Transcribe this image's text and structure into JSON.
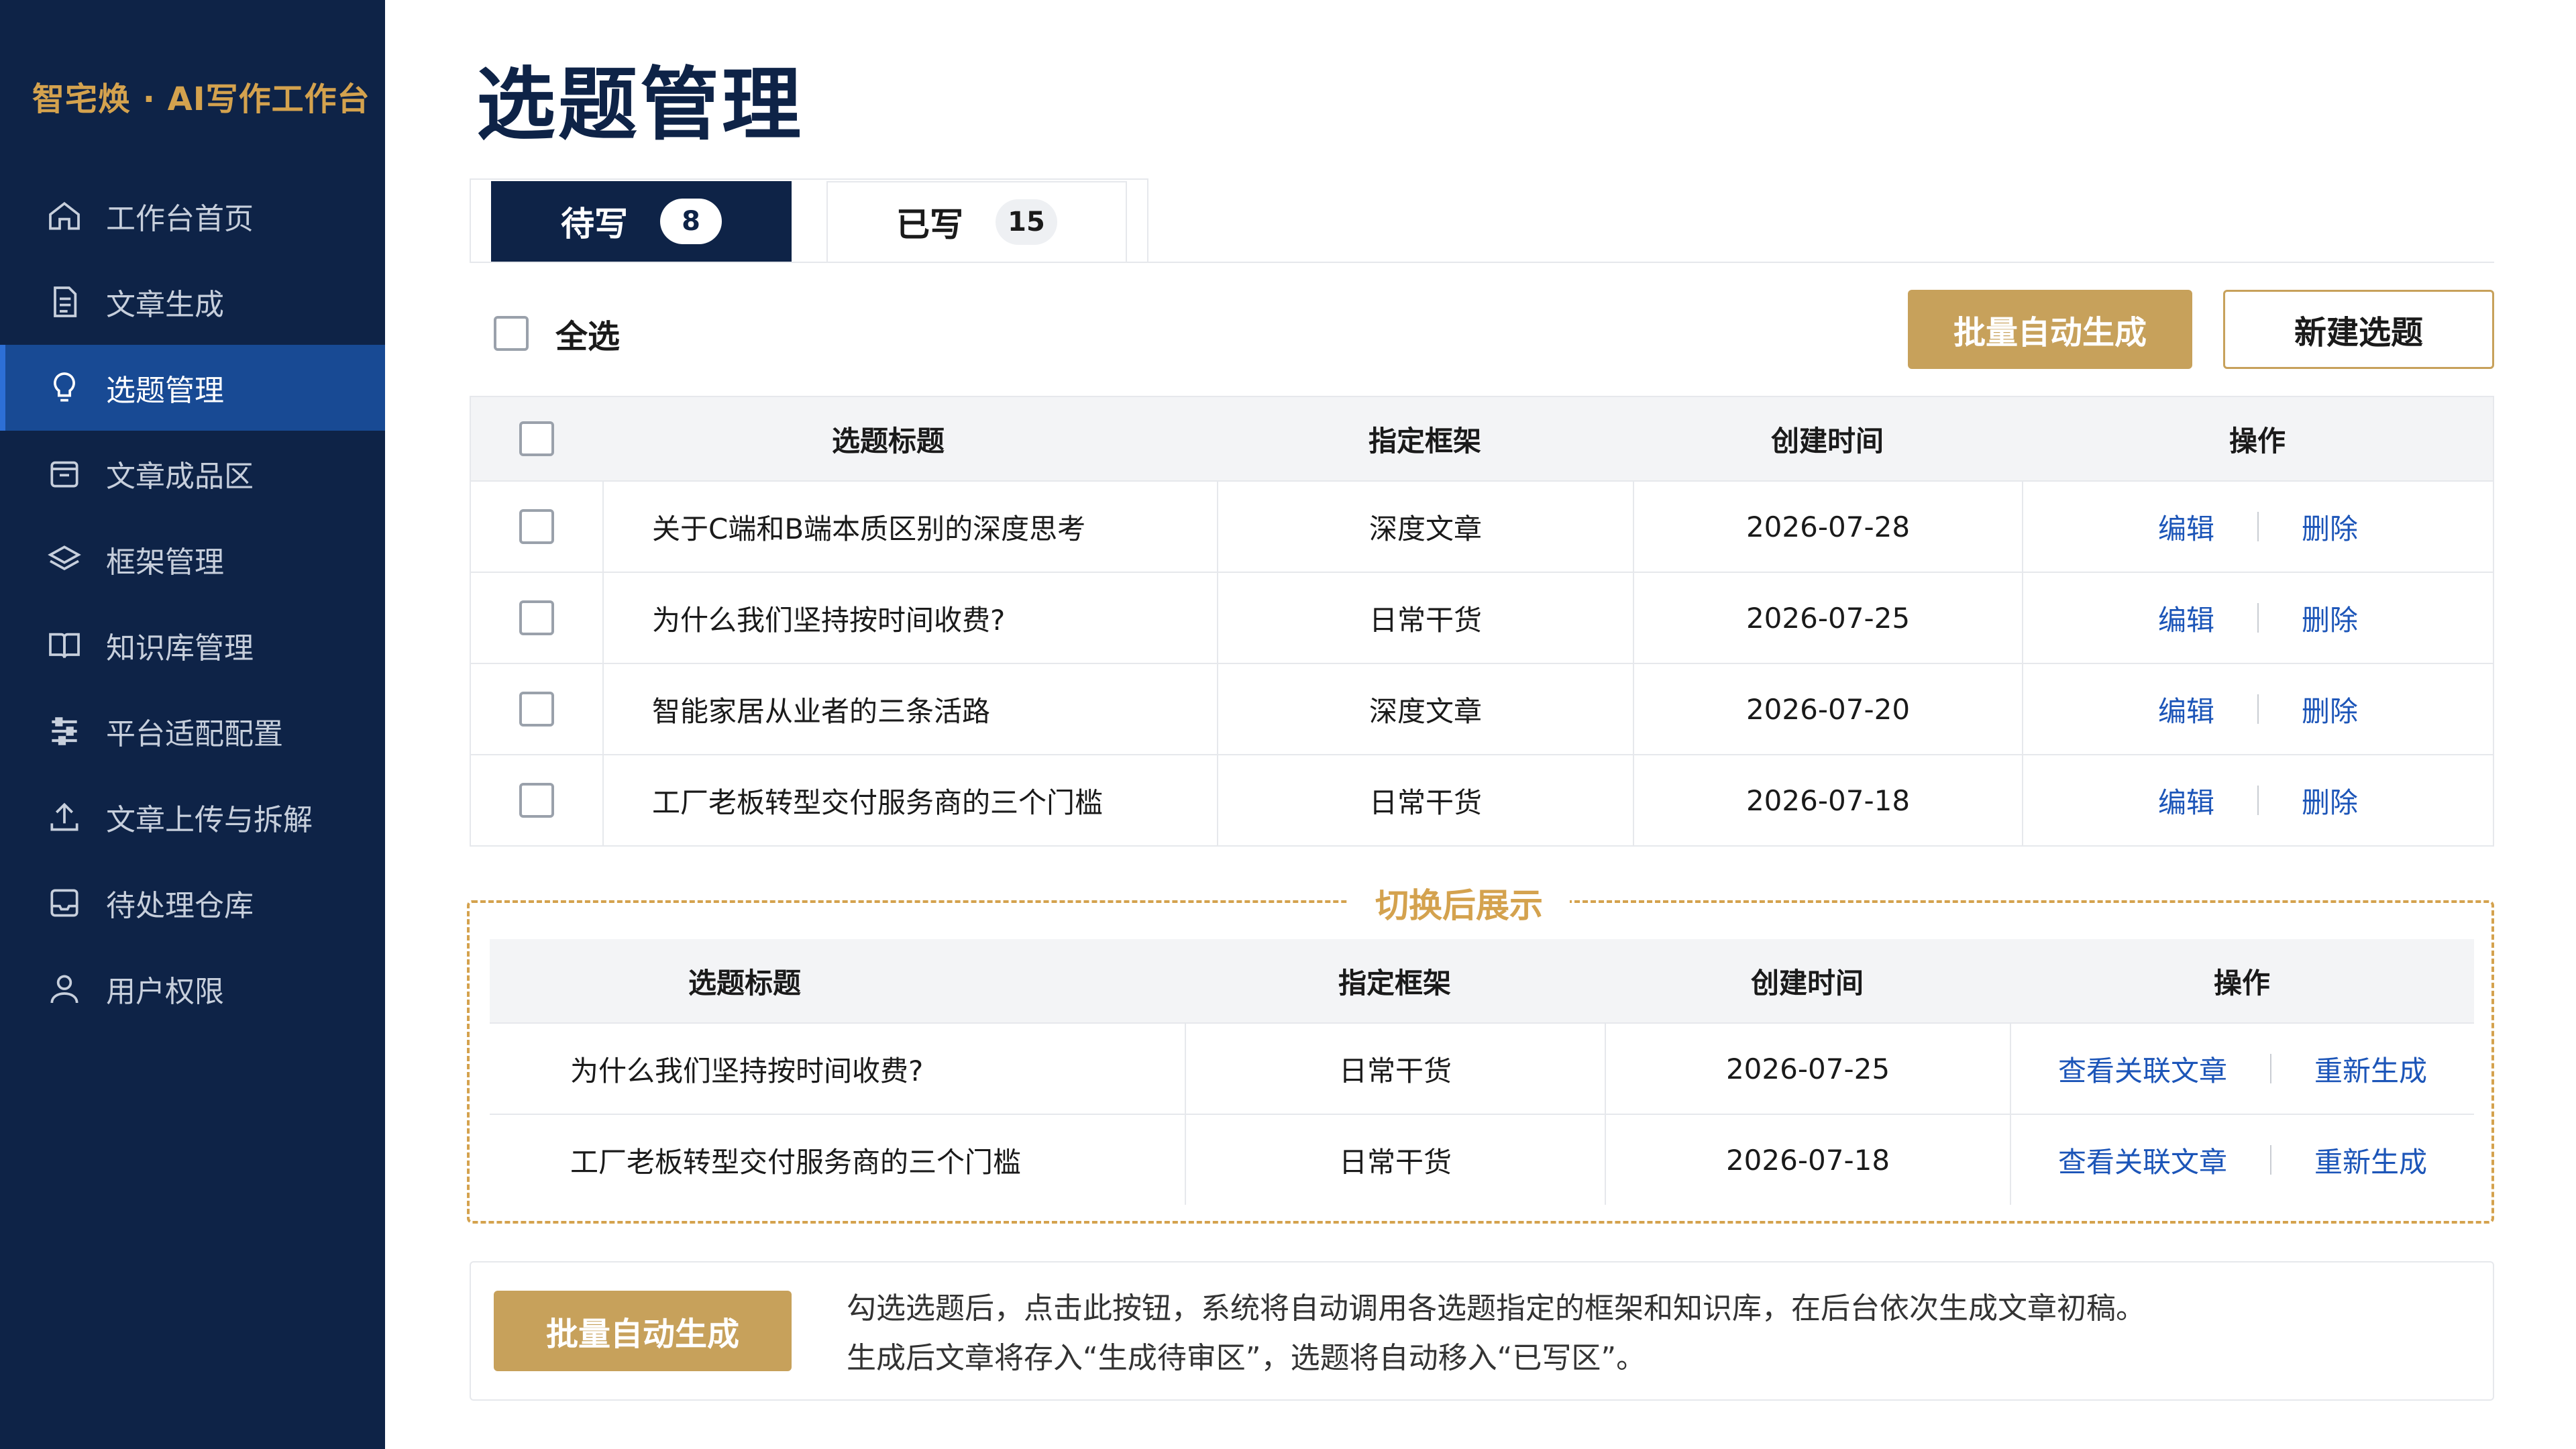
{
  "brand": "智宅焕 · AI写作工作台",
  "sidebar": {
    "items": [
      {
        "label": "工作台首页",
        "icon": "home-icon"
      },
      {
        "label": "文章生成",
        "icon": "document-icon"
      },
      {
        "label": "选题管理",
        "icon": "lightbulb-icon"
      },
      {
        "label": "文章成品区",
        "icon": "archive-box-icon"
      },
      {
        "label": "框架管理",
        "icon": "layers-icon"
      },
      {
        "label": "知识库管理",
        "icon": "book-icon"
      },
      {
        "label": "平台适配配置",
        "icon": "sliders-icon"
      },
      {
        "label": "文章上传与拆解",
        "icon": "upload-icon"
      },
      {
        "label": "待处理仓库",
        "icon": "inbox-icon"
      },
      {
        "label": "用户权限",
        "icon": "user-icon"
      }
    ],
    "active_index": 2
  },
  "page": {
    "title": "选题管理"
  },
  "tabs": [
    {
      "label": "待写",
      "count": "8"
    },
    {
      "label": "已写",
      "count": "15"
    }
  ],
  "toolbar": {
    "select_all": "全选",
    "batch_button": "批量自动生成",
    "new_button": "新建选题"
  },
  "table": {
    "headers": [
      "选题标题",
      "指定框架",
      "创建时间",
      "操作"
    ],
    "rows": [
      {
        "title": "关于C端和B端本质区别的深度思考",
        "frame": "深度文章",
        "date": "2026-07-28"
      },
      {
        "title": "为什么我们坚持按时间收费?",
        "frame": "日常干货",
        "date": "2026-07-25"
      },
      {
        "title": "智能家居从业者的三条活路",
        "frame": "深度文章",
        "date": "2026-07-20"
      },
      {
        "title": "工厂老板转型交付服务商的三个门槛",
        "frame": "日常干货",
        "date": "2026-07-18"
      }
    ],
    "edit_label": "编辑",
    "delete_label": "删除"
  },
  "preview": {
    "label": "切换后展示",
    "headers": [
      "选题标题",
      "指定框架",
      "创建时间",
      "操作"
    ],
    "rows": [
      {
        "title": "为什么我们坚持按时间收费?",
        "frame": "日常干货",
        "date": "2026-07-25"
      },
      {
        "title": "工厂老板转型交付服务商的三个门槛",
        "frame": "日常干货",
        "date": "2026-07-18"
      }
    ],
    "view_label": "查看关联文章",
    "regen_label": "重新生成"
  },
  "info": {
    "button": "批量自动生成",
    "line1": "勾选选题后，点击此按钮，系统将自动调用各选题指定的框架和知识库，在后台依次生成文章初稿。",
    "line2": "生成后文章将存入“生成待审区”，选题将自动移入“已写区”。"
  },
  "colors": {
    "sidebar_bg": "#0e2347",
    "active_bg": "#184a94",
    "gold": "#c7a15b",
    "link": "#1c55b8"
  }
}
